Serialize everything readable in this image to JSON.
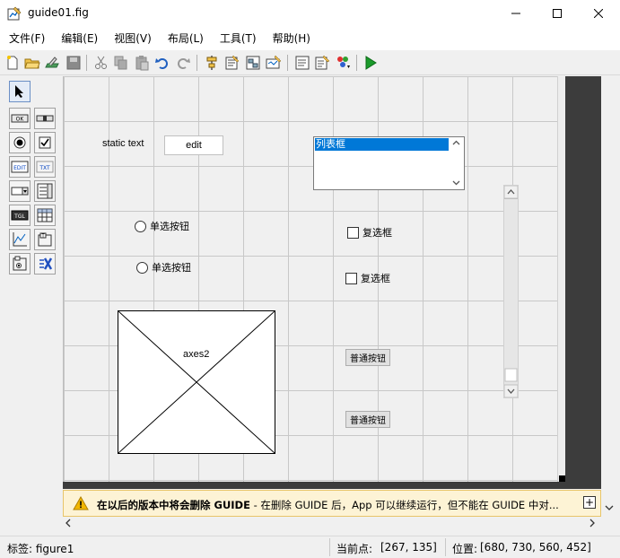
{
  "window": {
    "title": "guide01.fig"
  },
  "menu": [
    "文件(F)",
    "编辑(E)",
    "视图(V)",
    "布局(L)",
    "工具(T)",
    "帮助(H)"
  ],
  "components": {
    "static_text": "static text",
    "edit": "edit",
    "listbox_item": "列表框",
    "radio1": "单选按钮",
    "radio2": "单选按钮",
    "check1": "复选框",
    "check2": "复选框",
    "axes": "axes2",
    "push1": "普通按钮",
    "push2": "普通按钮"
  },
  "warning": {
    "bold": "在以后的版本中将会删除 GUIDE",
    "rest": " - 在删除 GUIDE 后，App 可以继续运行，但不能在 GUIDE 中对...",
    "expand": "+"
  },
  "status": {
    "tag": "标签: figure1",
    "current_point_label": "当前点:",
    "current_point": "[267, 135]",
    "position_label": "位置:",
    "position": "[680, 730, 560, 452]"
  },
  "icons": {
    "titlebar": "figure-icon",
    "toolbar": [
      "new-icon",
      "open-icon",
      "edit-icon",
      "save-icon",
      "cut-icon",
      "copy-icon",
      "paste-icon",
      "undo-icon",
      "redo-icon",
      "align-icon",
      "menu-editor-icon",
      "tab-order-icon",
      "toolbar-editor-icon",
      "editor-icon",
      "property-inspector-icon",
      "object-browser-icon",
      "run-icon"
    ],
    "palette": [
      "select-icon",
      "pushbutton-icon",
      "slider-icon",
      "radiobutton-icon",
      "checkbox-icon",
      "edit-text-icon",
      "static-text-icon",
      "popup-menu-icon",
      "listbox-icon",
      "toggle-button-icon",
      "table-icon",
      "axes-icon",
      "panel-icon",
      "button-group-icon",
      "activex-icon"
    ]
  },
  "colors": {
    "selection": "#0078d7",
    "warning_bg": "#fdf3d5",
    "run_green": "#1a9a2a"
  }
}
